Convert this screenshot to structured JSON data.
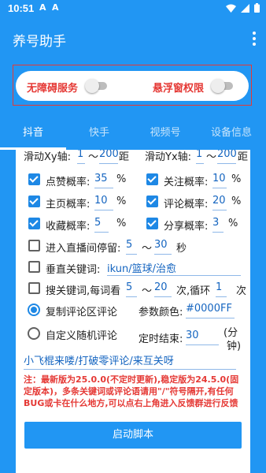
{
  "status_bar": {
    "time": "10:51",
    "icons": [
      "a-icon",
      "a-icon",
      "wifi-icon",
      "signal-icon",
      "battery-icon"
    ]
  },
  "app": {
    "title": "养号助手"
  },
  "permissions": {
    "accessibility_label": "无障碍服务",
    "overlay_label": "悬浮窗权限"
  },
  "tabs": [
    "抖音",
    "快手",
    "视频号",
    "设备信息"
  ],
  "settings": {
    "slide_x": {
      "label": "滑动Xy轴:",
      "from": "1",
      "to": "200",
      "unit": "距"
    },
    "slide_y": {
      "label": "滑动Yx轴:",
      "from": "1",
      "to": "200",
      "unit": "距"
    },
    "like": {
      "label": "点赞概率:",
      "value": "35",
      "unit": "%"
    },
    "follow": {
      "label": "关注概率:",
      "value": "10",
      "unit": "%"
    },
    "homepage": {
      "label": "主页概率:",
      "value": "10",
      "unit": "%"
    },
    "comment": {
      "label": "评论概率:",
      "value": "20",
      "unit": "%"
    },
    "favorite": {
      "label": "收藏概率:",
      "value": "5",
      "unit": "%"
    },
    "share": {
      "label": "分享概率:",
      "value": "3",
      "unit": "%"
    },
    "live": {
      "label": "进入直播间停留:",
      "from": "5",
      "sep": "～",
      "to": "30",
      "unit": "秒"
    },
    "vertical_kw": {
      "label": "垂直关键词:",
      "value": "ikun/篮球/治愈"
    },
    "search_kw": {
      "label": "搜关键词,每词看",
      "from": "5",
      "sep": "～",
      "to": "20",
      "mid": "次,循环",
      "loop": "1",
      "unit": "次"
    },
    "copy_comment": {
      "label": "复制评论区评论"
    },
    "param_color": {
      "label": "参数颜色:",
      "value": "#0000FF"
    },
    "custom_comment": {
      "label": "自定义随机评论"
    },
    "timed_end": {
      "label": "定时结束:",
      "value": "30",
      "unit_line1": "(分",
      "unit_line2": "钟)"
    },
    "comment_text": "小飞棍来喽/打破零评论/来互关呀",
    "note": "注：最新版为25.0.0(不定时更新),稳定版为24.5.0(固定版本)，多条关键词或评论语请用\"/\"符号隔开,有任何BUG或卡在什么地方,可以点右上角进入反馈群进行反馈",
    "start_button": "启动脚本"
  }
}
